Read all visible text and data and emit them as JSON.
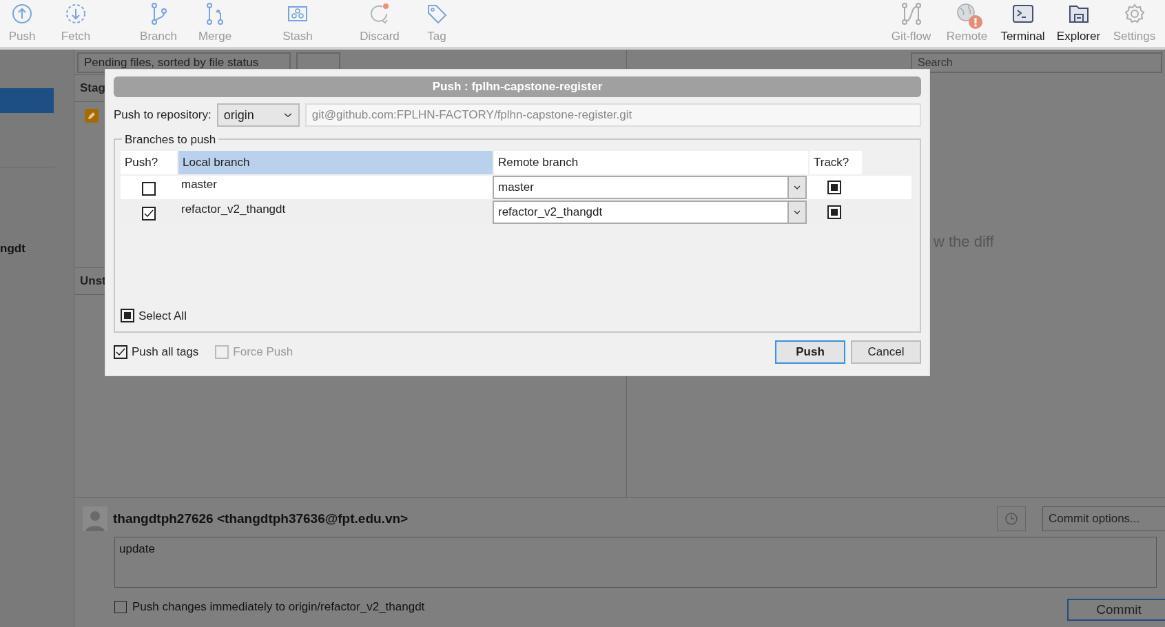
{
  "toolbar": {
    "left": [
      {
        "label": "Push",
        "kind": "push",
        "active": false
      },
      {
        "label": "Fetch",
        "kind": "fetch",
        "active": false
      },
      {
        "label": "Branch",
        "kind": "branch",
        "active": false
      },
      {
        "label": "Merge",
        "kind": "merge",
        "active": false
      },
      {
        "label": "Stash",
        "kind": "stash",
        "active": false
      },
      {
        "label": "Discard",
        "kind": "discard",
        "active": false
      },
      {
        "label": "Tag",
        "kind": "tag",
        "active": false
      }
    ],
    "right": [
      {
        "label": "Git-flow",
        "kind": "gitflow",
        "active": false,
        "alert": false
      },
      {
        "label": "Remote",
        "kind": "remote",
        "active": false,
        "alert": true
      },
      {
        "label": "Terminal",
        "kind": "terminal",
        "active": true,
        "alert": false
      },
      {
        "label": "Explorer",
        "kind": "explorer",
        "active": true,
        "alert": false
      },
      {
        "label": "Settings",
        "kind": "settings",
        "active": false,
        "alert": false
      }
    ]
  },
  "sidebar": {
    "fragment": "ngdt"
  },
  "file_panel": {
    "filter": "Pending files, sorted by file status",
    "staged_header": "Stag",
    "unstaged_header": "Unst"
  },
  "diff_panel": {
    "search_placeholder": "Search",
    "hint": "w the diff"
  },
  "commit": {
    "author": "thangdtph27626 <thangdtph37636@fpt.edu.vn>",
    "message": "update",
    "options": "Commit options...",
    "push_immediately": {
      "label": "Push changes immediately to origin/refactor_v2_thangdt",
      "checked": false
    },
    "button": "Commit"
  },
  "dialog": {
    "title": "Push :  fplhn-capstone-register",
    "repo_label": "Push to repository:",
    "repo": "origin",
    "url": "git@github.com:FPLHN-FACTORY/fplhn-capstone-register.git",
    "group": "Branches to push",
    "columns": [
      {
        "label": "Push?",
        "selected": false
      },
      {
        "label": "Local branch",
        "selected": true
      },
      {
        "label": "Remote branch",
        "selected": false
      },
      {
        "label": "Track?",
        "selected": false
      }
    ],
    "rows": [
      {
        "push": false,
        "local": "master",
        "remote": "master",
        "track": true,
        "selected": true
      },
      {
        "push": true,
        "local": "refactor_v2_thangdt",
        "remote": "refactor_v2_thangdt",
        "track": true,
        "selected": false
      }
    ],
    "select_all": {
      "label": "Select All",
      "mixed": true
    },
    "options": [
      {
        "label": "Push all tags",
        "checked": true,
        "disabled": false
      },
      {
        "label": "Force Push",
        "checked": false,
        "disabled": true
      }
    ],
    "buttons": [
      {
        "label": "Push",
        "default": true
      },
      {
        "label": "Cancel",
        "default": false
      }
    ]
  }
}
